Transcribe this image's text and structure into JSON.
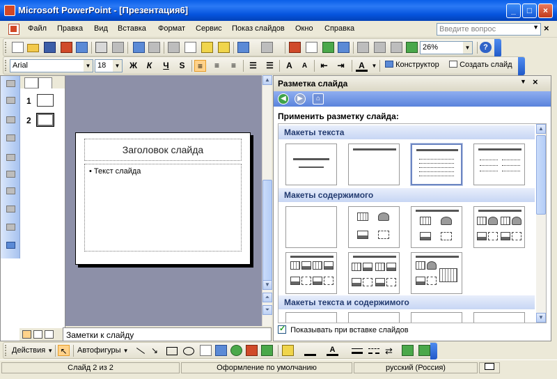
{
  "window": {
    "title": "Microsoft PowerPoint - [Презентация6]",
    "min_label": "_",
    "max_label": "□",
    "close_label": "×"
  },
  "menu": {
    "items": [
      "Файл",
      "Правка",
      "Вид",
      "Вставка",
      "Формат",
      "Сервис",
      "Показ слайдов",
      "Окно",
      "Справка"
    ],
    "help_placeholder": "Введите вопрос",
    "close_label": "×"
  },
  "standard_toolbar": {
    "zoom": "26%",
    "help_label": "?"
  },
  "formatting_toolbar": {
    "font": "Arial",
    "size": "18",
    "bold": "Ж",
    "italic": "К",
    "underline": "Ч",
    "shadow": "S",
    "grow_font": "A",
    "shrink_font": "A",
    "font_color": "A",
    "designer": "Конструктор",
    "new_slide": "Создать слайд"
  },
  "slides_panel": {
    "slides": [
      {
        "num": "1"
      },
      {
        "num": "2",
        "selected": true
      }
    ]
  },
  "slide": {
    "title_placeholder": "Заголовок слайда",
    "body_placeholder": "Текст слайда",
    "bullet": "•"
  },
  "notes": {
    "placeholder": "Заметки к слайду"
  },
  "task_pane": {
    "title": "Разметка слайда",
    "apply_label": "Применить разметку слайда:",
    "sections": [
      {
        "label": "Макеты текста"
      },
      {
        "label": "Макеты содержимого"
      },
      {
        "label": "Макеты текста и содержимого"
      }
    ],
    "show_on_insert": "Показывать при вставке слайдов"
  },
  "drawing_toolbar": {
    "actions": "Действия",
    "autoshapes": "Автофигуры"
  },
  "status_bar": {
    "slide_pos": "Слайд 2 из 2",
    "design": "Оформление по умолчанию",
    "language": "русский (Россия)"
  }
}
